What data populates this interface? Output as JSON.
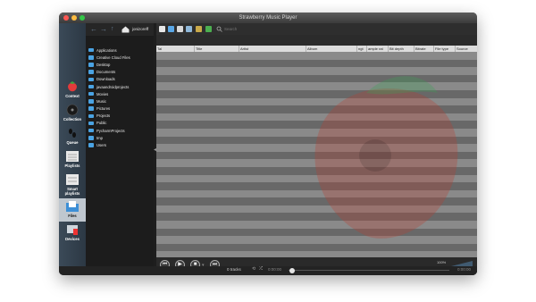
{
  "window": {
    "title": "Strawberry Music Player"
  },
  "sidebar": {
    "items": [
      {
        "label": "Context",
        "icon": "strawberry-icon"
      },
      {
        "label": "Collection",
        "icon": "collection-disc-icon"
      },
      {
        "label": "Queue",
        "icon": "queue-icon"
      },
      {
        "label": "Playlists",
        "icon": "playlists-icon"
      },
      {
        "label": "Smart\nplaylists",
        "icon": "smart-playlists-icon"
      },
      {
        "label": "Files",
        "icon": "files-icon"
      },
      {
        "label": "Devices",
        "icon": "devices-icon"
      }
    ],
    "active": "Files"
  },
  "files": {
    "path": "jonizoreff",
    "folders": [
      "Applications",
      "Creative Cloud Files",
      "Desktop",
      "Documents",
      "Downloads",
      "javaandroidprojects",
      "Movies",
      "Music",
      "Pictures",
      "Projects",
      "Public",
      "PycharmProjects",
      "tmp",
      "Users"
    ]
  },
  "toolbar": {
    "search_placeholder": "Search"
  },
  "playlist": {
    "columns": [
      "Tal",
      "Title",
      "Artist",
      "Album",
      "ngt",
      "ample rat",
      "Bit depth",
      "Bitrate",
      "File type",
      "Source"
    ],
    "row_count": 27
  },
  "status": {
    "tracks": "0 tracks",
    "elapsed": "0:00:00",
    "remaining": "0:00:00"
  },
  "volume": {
    "label": "100%",
    "level": 1.0
  },
  "colors": {
    "accent": "#4aa3e3",
    "active_tab": "#bfc7cf"
  }
}
